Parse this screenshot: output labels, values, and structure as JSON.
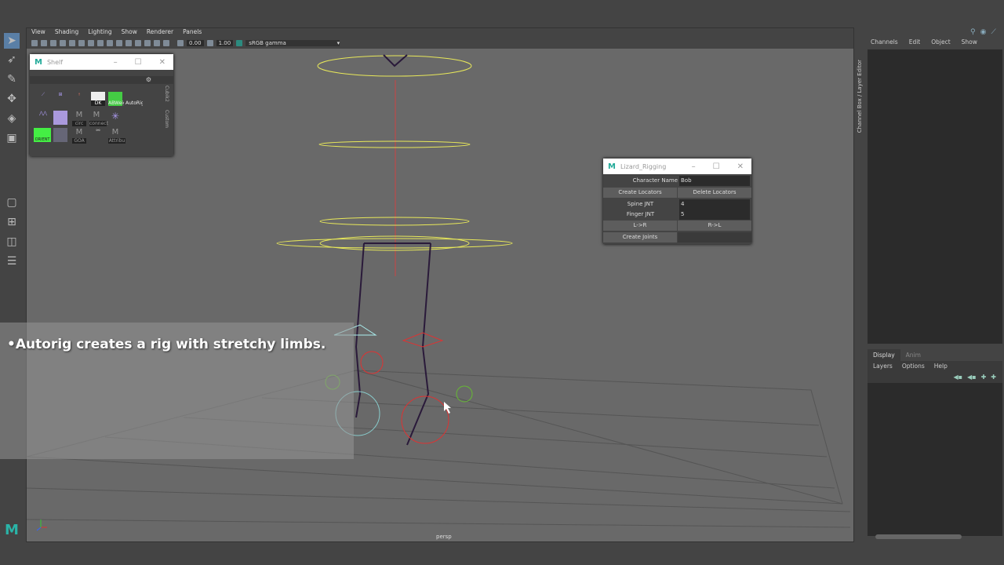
{
  "viewport": {
    "menu": [
      "View",
      "Shading",
      "Lighting",
      "Show",
      "Renderer",
      "Panels"
    ],
    "exposure": "0.00",
    "gamma": "1.00",
    "color_space": "sRGB gamma",
    "camera_label": "persp"
  },
  "shelf": {
    "title": "Shelf",
    "tabs": [
      "Cubik2",
      "Custom"
    ],
    "buttons": [
      "",
      "",
      "",
      "DK",
      "ABWeig",
      "AutoRig",
      "",
      "",
      "circ",
      "connect",
      "",
      "ORIENT",
      "",
      "GOA",
      "",
      "Attribu"
    ]
  },
  "lizard": {
    "title": "Lizard_Rigging",
    "char_name_label": "Character Name",
    "char_name": "Bob",
    "create_locators": "Create Locators",
    "delete_locators": "Delete Locators",
    "spine_label": "Spine JNT",
    "spine_value": "4",
    "finger_label": "Finger JNT",
    "finger_value": "5",
    "l_to_r": "L->R",
    "r_to_l": "R->L",
    "create_joints": "Create Joints"
  },
  "right_panel": {
    "vertical_tab": "Channel Box / Layer Editor",
    "channel_menu": [
      "Channels",
      "Edit",
      "Object",
      "Show"
    ],
    "layer_tabs": [
      "Display",
      "Anim"
    ],
    "layer_menu": [
      "Layers",
      "Options",
      "Help"
    ]
  },
  "subtitle": "•Autorig creates a rig with stretchy limbs.",
  "logo": "M"
}
